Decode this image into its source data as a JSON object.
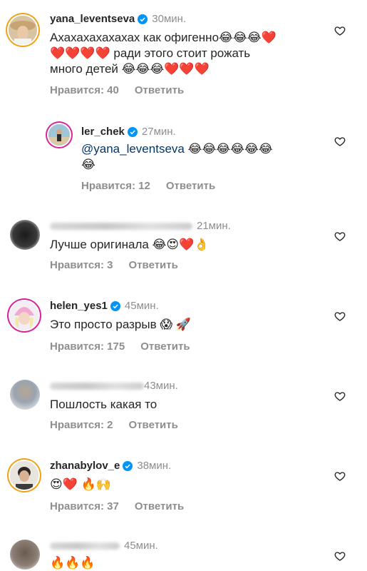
{
  "comments": [
    {
      "username": "yana_leventseva",
      "verified": true,
      "time": "30мин.",
      "text_line1": "Ахахахахахахах как офигенно😂😂😂❤️",
      "text_line2": "❤️❤️❤️❤️ ради этого стоит рожать",
      "text_line3": "много детей 😂😂😂❤️❤️❤️",
      "likes": "Нравится: 40",
      "reply": "Ответить",
      "avatar": "avatar-woman-hat"
    },
    {
      "username": "ler_chek",
      "verified": true,
      "time": "27мин.",
      "mention": "@yana_leventseva",
      "text_after_mention": " 😂😂😂😂😂😂",
      "text_line2": "😂",
      "likes": "Нравится: 12",
      "reply": "Ответить",
      "avatar": "avatar-woman-beach"
    },
    {
      "username": "",
      "verified": false,
      "time": "21мин.",
      "text_line1": "Лучше оригинала 😂😍❤️👌",
      "likes": "Нравится: 3",
      "reply": "Ответить",
      "avatar": "avatar-dark"
    },
    {
      "username": "helen_yes1",
      "verified": true,
      "time": "45мин.",
      "text_line1": "Это просто разрыв 😱 🚀",
      "likes": "Нравится: 175",
      "reply": "Ответить",
      "avatar": "avatar-pink-hat"
    },
    {
      "username": "",
      "verified": false,
      "time": "43мин.",
      "text_line1": "Пошлость какая то",
      "likes": "Нравится: 2",
      "reply": "Ответить",
      "avatar": "avatar-blurred-light"
    },
    {
      "username": "zhanabylov_e",
      "verified": true,
      "time": "38мин.",
      "text_line1": "😍❤️ 🔥🙌",
      "likes": "Нравится: 37",
      "reply": "Ответить",
      "avatar": "avatar-man"
    },
    {
      "username": "",
      "verified": false,
      "time": "45мин.",
      "text_line1": "🔥🔥🔥",
      "avatar": "avatar-blurred-dark"
    }
  ],
  "colors": {
    "text": "#262626",
    "secondary": "#8e8e8e",
    "mention": "#00376b",
    "verified": "#0095f6"
  }
}
